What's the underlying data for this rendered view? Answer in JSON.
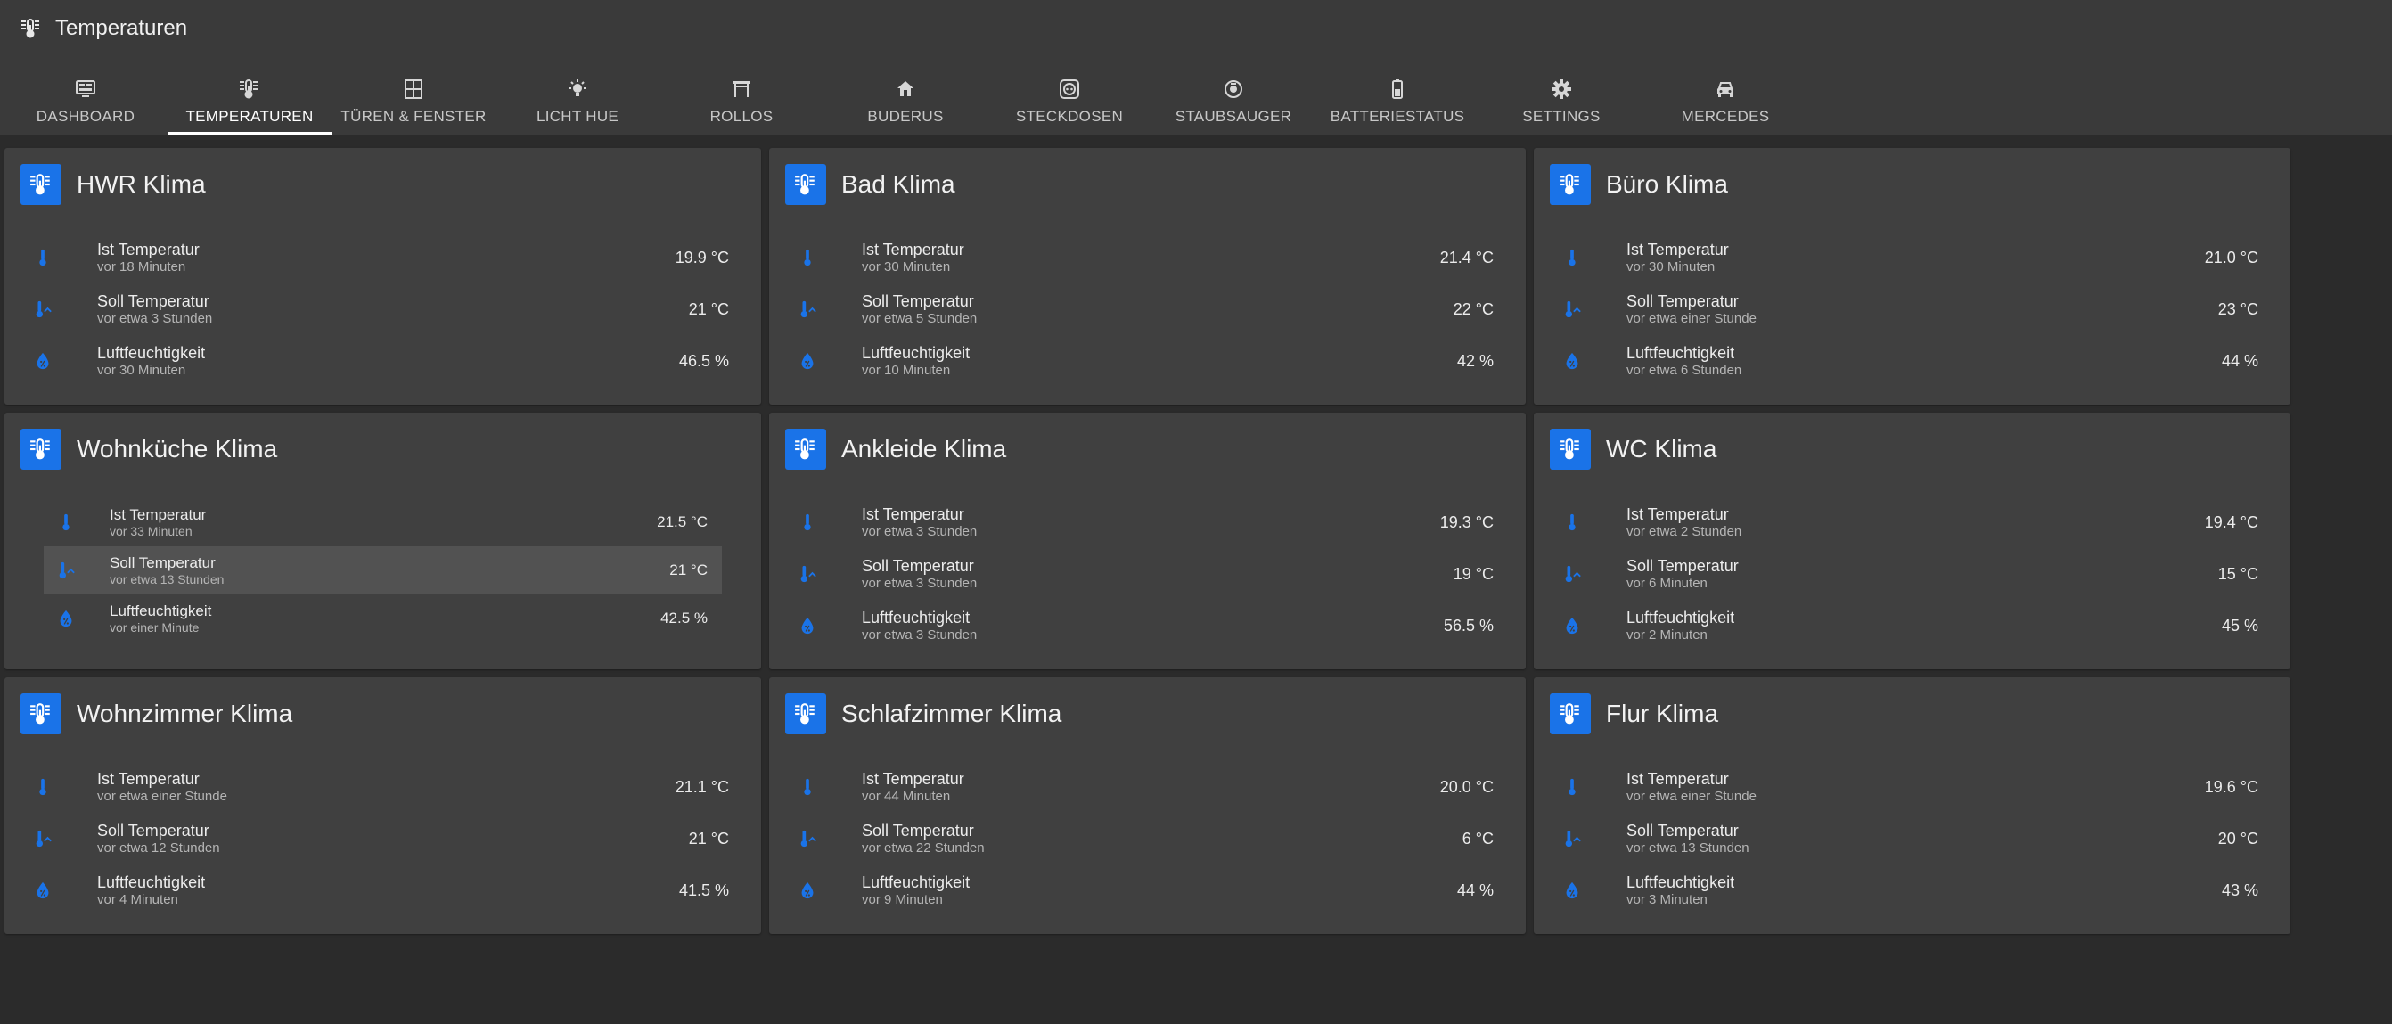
{
  "app": {
    "title": "Temperaturen",
    "title_icon": "thermometer-lines-icon"
  },
  "colors": {
    "accent": "#1a73e8",
    "header_bg": "#3a3a3a",
    "card_bg": "#404040",
    "page_bg": "#2b2b2b"
  },
  "tabs": [
    {
      "label": "DASHBOARD",
      "icon": "monitor-dashboard-icon",
      "active": false
    },
    {
      "label": "TEMPERATUREN",
      "icon": "thermometer-lines-icon",
      "active": true
    },
    {
      "label": "TÜREN & FENSTER",
      "icon": "window-icon",
      "active": false
    },
    {
      "label": "LICHT HUE",
      "icon": "lightbulb-icon",
      "active": false
    },
    {
      "label": "ROLLOS",
      "icon": "blinds-icon",
      "active": false
    },
    {
      "label": "BUDERUS",
      "icon": "home-heat-icon",
      "active": false
    },
    {
      "label": "STECKDOSEN",
      "icon": "power-socket-icon",
      "active": false
    },
    {
      "label": "STAUBSAUGER",
      "icon": "robot-vacuum-icon",
      "active": false
    },
    {
      "label": "BATTERIESTATUS",
      "icon": "battery-icon",
      "active": false
    },
    {
      "label": "SETTINGS",
      "icon": "gear-icon",
      "active": false
    },
    {
      "label": "MERCEDES",
      "icon": "car-icon",
      "active": false
    }
  ],
  "cards": [
    {
      "title": "HWR Klima",
      "rows": [
        {
          "name": "Ist Temperatur",
          "sub": "vor 18 Minuten",
          "value": "19.9 °C",
          "icon": "thermometer-icon"
        },
        {
          "name": "Soll Temperatur",
          "sub": "vor etwa 3 Stunden",
          "value": "21 °C",
          "icon": "thermometer-chevron-up-icon"
        },
        {
          "name": "Luftfeuchtigkeit",
          "sub": "vor 30 Minuten",
          "value": "46.5 %",
          "icon": "water-percent-icon"
        }
      ]
    },
    {
      "title": "Bad Klima",
      "rows": [
        {
          "name": "Ist Temperatur",
          "sub": "vor 30 Minuten",
          "value": "21.4 °C",
          "icon": "thermometer-icon"
        },
        {
          "name": "Soll Temperatur",
          "sub": "vor etwa 5 Stunden",
          "value": "22 °C",
          "icon": "thermometer-chevron-up-icon"
        },
        {
          "name": "Luftfeuchtigkeit",
          "sub": "vor 10 Minuten",
          "value": "42 %",
          "icon": "water-percent-icon"
        }
      ]
    },
    {
      "title": "Büro Klima",
      "rows": [
        {
          "name": "Ist Temperatur",
          "sub": "vor 30 Minuten",
          "value": "21.0 °C",
          "icon": "thermometer-icon"
        },
        {
          "name": "Soll Temperatur",
          "sub": "vor etwa einer Stunde",
          "value": "23 °C",
          "icon": "thermometer-chevron-up-icon"
        },
        {
          "name": "Luftfeuchtigkeit",
          "sub": "vor etwa 6 Stunden",
          "value": "44 %",
          "icon": "water-percent-icon"
        }
      ]
    },
    {
      "title": "Wohnküche Klima",
      "compact": true,
      "rows": [
        {
          "name": "Ist Temperatur",
          "sub": "vor 33 Minuten",
          "value": "21.5 °C",
          "icon": "thermometer-icon"
        },
        {
          "name": "Soll Temperatur",
          "sub": "vor etwa 13 Stunden",
          "value": "21 °C",
          "icon": "thermometer-chevron-up-icon",
          "highlight": true
        },
        {
          "name": "Luftfeuchtigkeit",
          "sub": "vor einer Minute",
          "value": "42.5 %",
          "icon": "water-percent-icon"
        }
      ]
    },
    {
      "title": "Ankleide Klima",
      "rows": [
        {
          "name": "Ist Temperatur",
          "sub": "vor etwa 3 Stunden",
          "value": "19.3 °C",
          "icon": "thermometer-icon"
        },
        {
          "name": "Soll Temperatur",
          "sub": "vor etwa 3 Stunden",
          "value": "19 °C",
          "icon": "thermometer-chevron-up-icon"
        },
        {
          "name": "Luftfeuchtigkeit",
          "sub": "vor etwa 3 Stunden",
          "value": "56.5 %",
          "icon": "water-percent-icon"
        }
      ]
    },
    {
      "title": "WC Klima",
      "rows": [
        {
          "name": "Ist Temperatur",
          "sub": "vor etwa 2 Stunden",
          "value": "19.4 °C",
          "icon": "thermometer-icon"
        },
        {
          "name": "Soll Temperatur",
          "sub": "vor 6 Minuten",
          "value": "15 °C",
          "icon": "thermometer-chevron-up-icon"
        },
        {
          "name": "Luftfeuchtigkeit",
          "sub": "vor 2 Minuten",
          "value": "45 %",
          "icon": "water-percent-icon"
        }
      ]
    },
    {
      "title": "Wohnzimmer Klima",
      "rows": [
        {
          "name": "Ist Temperatur",
          "sub": "vor etwa einer Stunde",
          "value": "21.1 °C",
          "icon": "thermometer-icon"
        },
        {
          "name": "Soll Temperatur",
          "sub": "vor etwa 12 Stunden",
          "value": "21 °C",
          "icon": "thermometer-chevron-up-icon"
        },
        {
          "name": "Luftfeuchtigkeit",
          "sub": "vor 4 Minuten",
          "value": "41.5 %",
          "icon": "water-percent-icon"
        }
      ]
    },
    {
      "title": "Schlafzimmer Klima",
      "rows": [
        {
          "name": "Ist Temperatur",
          "sub": "vor 44 Minuten",
          "value": "20.0 °C",
          "icon": "thermometer-icon"
        },
        {
          "name": "Soll Temperatur",
          "sub": "vor etwa 22 Stunden",
          "value": "6 °C",
          "icon": "thermometer-chevron-up-icon"
        },
        {
          "name": "Luftfeuchtigkeit",
          "sub": "vor 9 Minuten",
          "value": "44 %",
          "icon": "water-percent-icon"
        }
      ]
    },
    {
      "title": "Flur Klima",
      "rows": [
        {
          "name": "Ist Temperatur",
          "sub": "vor etwa einer Stunde",
          "value": "19.6 °C",
          "icon": "thermometer-icon"
        },
        {
          "name": "Soll Temperatur",
          "sub": "vor etwa 13 Stunden",
          "value": "20 °C",
          "icon": "thermometer-chevron-up-icon"
        },
        {
          "name": "Luftfeuchtigkeit",
          "sub": "vor 3 Minuten",
          "value": "43 %",
          "icon": "water-percent-icon"
        }
      ]
    }
  ]
}
